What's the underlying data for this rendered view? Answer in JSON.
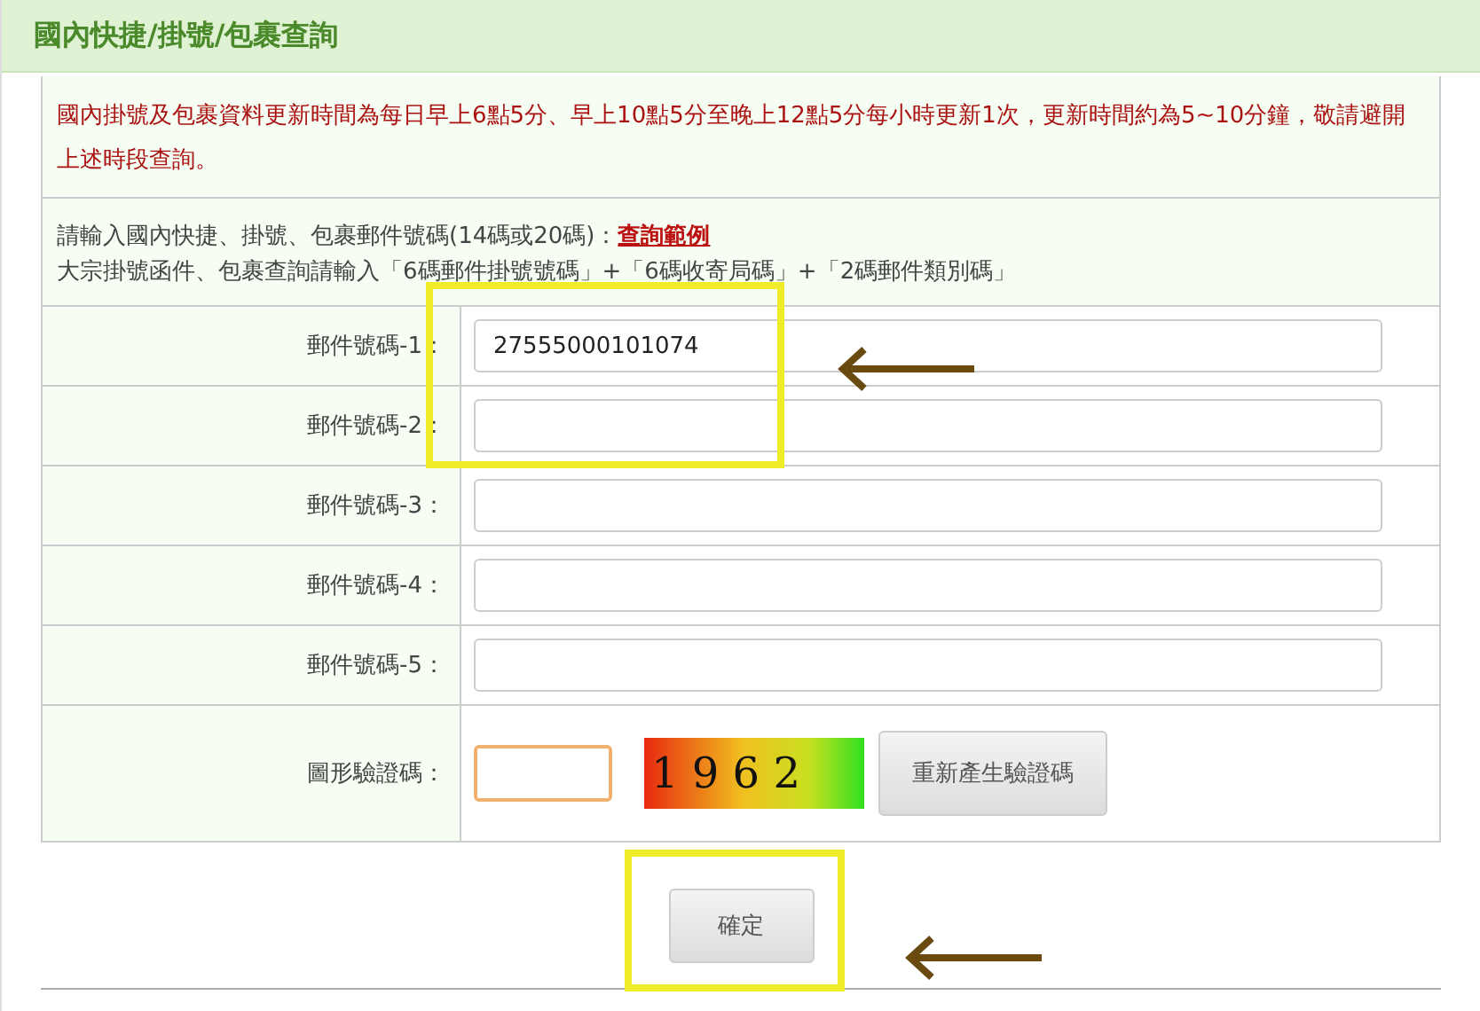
{
  "header": {
    "title": "國內快捷/掛號/包裹查詢"
  },
  "notice": "國內掛號及包裹資料更新時間為每日早上6點5分、早上10點5分至晚上12點5分每小時更新1次，更新時間約為5~10分鐘，敬請避開上述時段查詢。",
  "instructions": {
    "line1": "請輸入國內快捷、掛號、包裹郵件號碼(14碼或20碼)：",
    "link": "查詢範例",
    "line2": "大宗掛號函件、包裹查詢請輸入「6碼郵件掛號號碼」+「6碼收寄局碼」+「2碼郵件類別碼」"
  },
  "fields": [
    {
      "label": "郵件號碼-1：",
      "value": "27555000101074"
    },
    {
      "label": "郵件號碼-2："
    },
    {
      "label": "郵件號碼-3："
    },
    {
      "label": "郵件號碼-4："
    },
    {
      "label": "郵件號碼-5："
    }
  ],
  "captcha": {
    "label": "圖形驗證碼：",
    "focused": true,
    "code": "1 9 6 2",
    "refresh_button": "重新產生驗證碼"
  },
  "submit_button": "確定"
}
